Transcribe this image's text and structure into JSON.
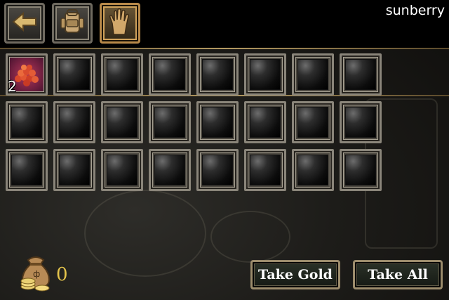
{
  "header": {
    "player_name": "sunberry",
    "tabs": [
      {
        "icon": "back-arrow-icon"
      },
      {
        "icon": "backpack-icon"
      },
      {
        "icon": "hand-icon",
        "active": true
      }
    ]
  },
  "loot": {
    "slots_per_row": 8,
    "rows": 3,
    "items": [
      {
        "slot": 0,
        "icon": "red-gems-pile-icon",
        "count": "2"
      }
    ]
  },
  "footer": {
    "gold_icon": "gold-sack-icon",
    "gold_amount": "0",
    "take_gold_label": "Take Gold",
    "take_all_label": "Take All"
  },
  "colors": {
    "accent_gold": "#e4c44b",
    "frame": "#8a857a",
    "active_tab": "#b98a4a"
  }
}
